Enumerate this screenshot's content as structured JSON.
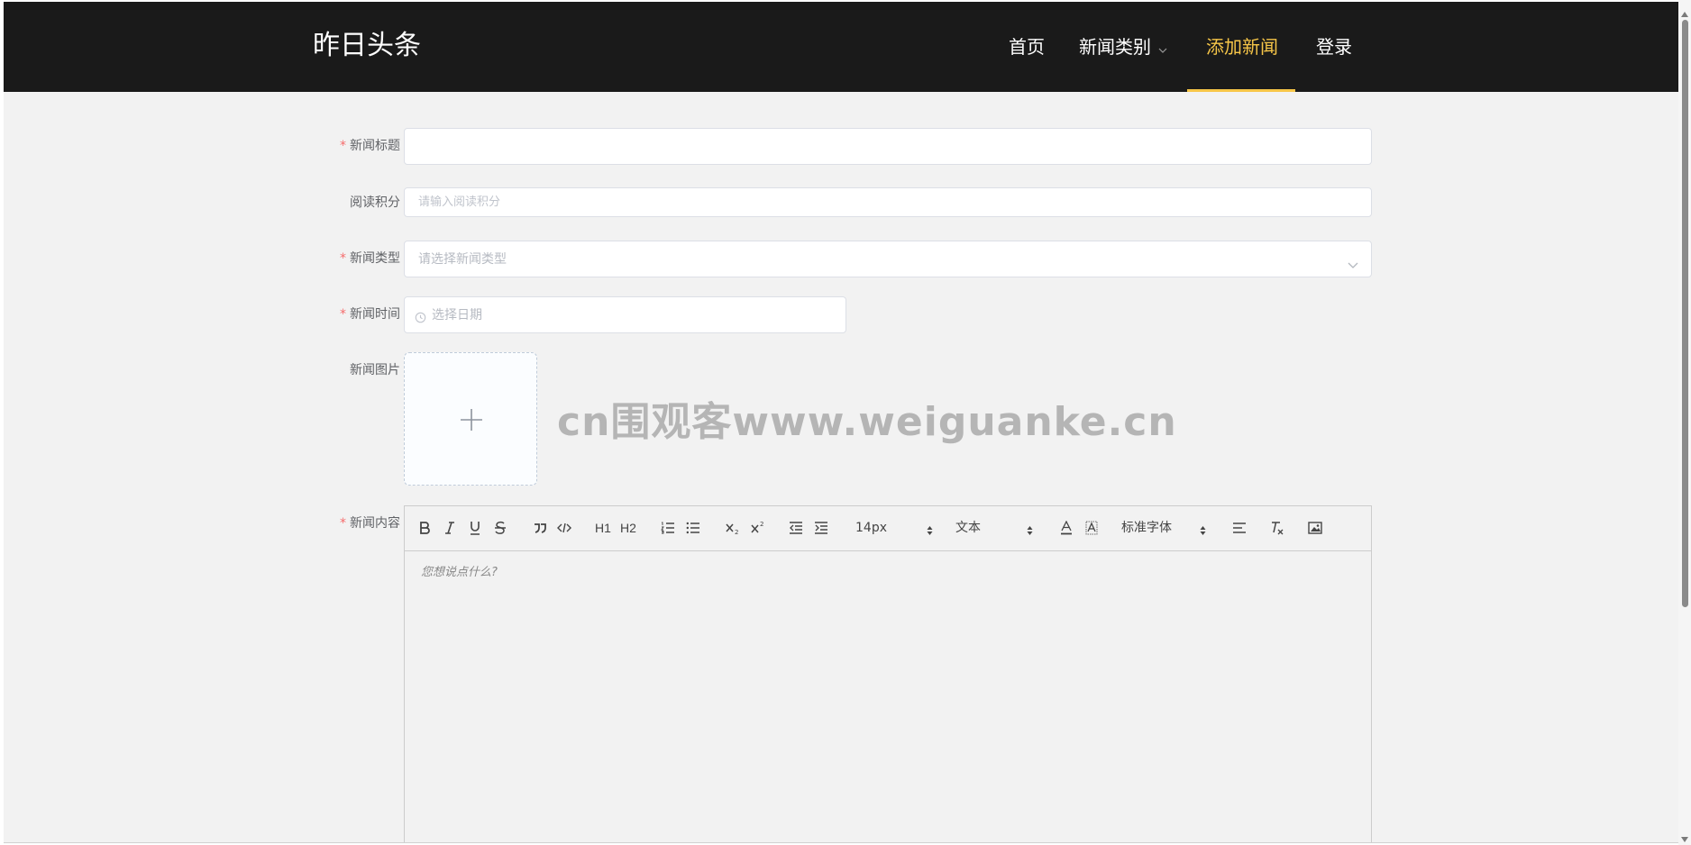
{
  "header": {
    "logo": "昨日头条",
    "nav": [
      {
        "label": "首页"
      },
      {
        "label": "新闻类别"
      },
      {
        "label": "添加新闻"
      },
      {
        "label": "登录"
      }
    ]
  },
  "form": {
    "title": {
      "label": "新闻标题",
      "value": ""
    },
    "points": {
      "label": "阅读积分",
      "placeholder": "请输入阅读积分"
    },
    "type": {
      "label": "新闻类型",
      "placeholder": "请选择新闻类型"
    },
    "time": {
      "label": "新闻时间",
      "placeholder": "选择日期"
    },
    "image": {
      "label": "新闻图片"
    },
    "content": {
      "label": "新闻内容",
      "placeholder": "您想说点什么?",
      "toolbar": {
        "h1": "H1",
        "h2": "H2",
        "size": "14px",
        "header": "文本",
        "font": "标准字体"
      }
    }
  },
  "watermark": "cn围观客www.weiguanke.cn"
}
